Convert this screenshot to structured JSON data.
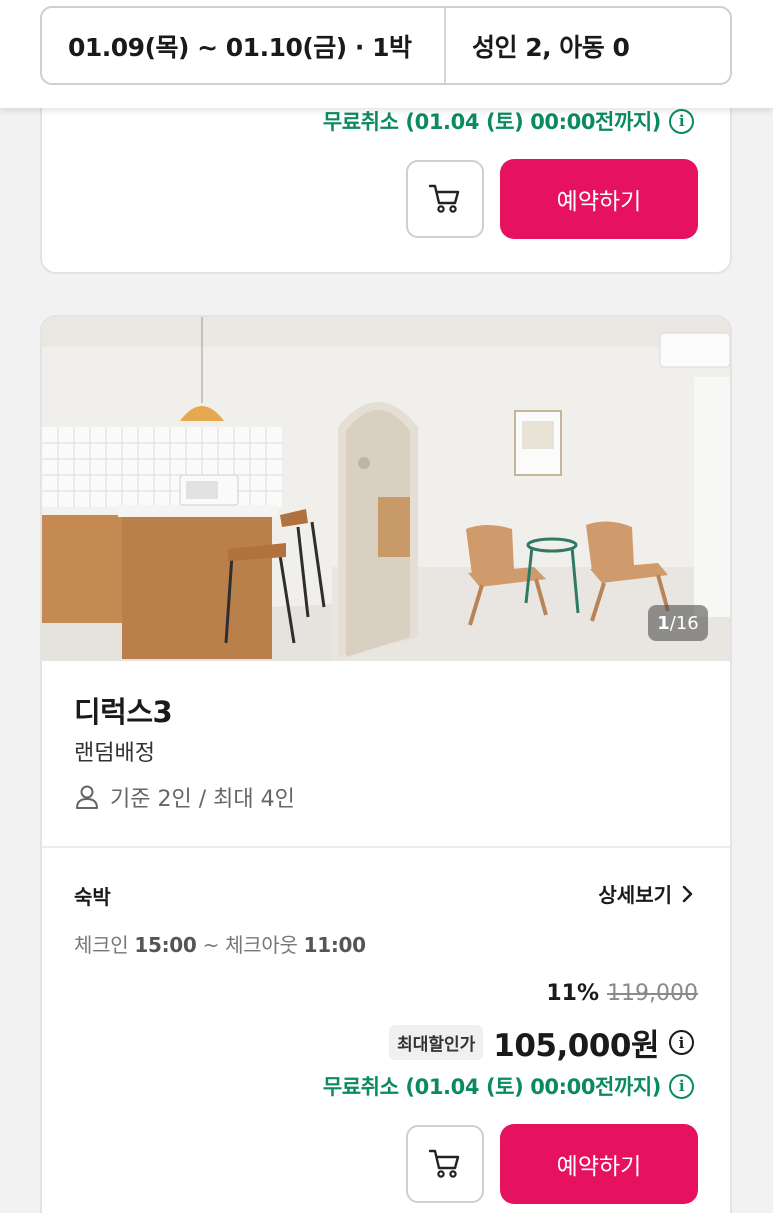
{
  "search": {
    "date_range": "01.09(목) ~ 01.10(금) · 1박",
    "guests": "성인 2, 아동 0"
  },
  "prev_room": {
    "free_cancel": "무료취소 (01.04 (토) 00:00전까지)",
    "reserve_label": "예약하기"
  },
  "room": {
    "photo_counter_current": "1",
    "photo_counter_total": "/16",
    "name": "디럭스3",
    "type": "랜덤배정",
    "capacity": "기준 2인 / 최대 4인",
    "stay_label": "숙박",
    "details_label": "상세보기",
    "checkin_label": "체크인",
    "checkin_time": "15:00",
    "separator": "~",
    "checkout_label": "체크아웃",
    "checkout_time": "11:00",
    "discount_pct": "11%",
    "original_price": "119,000",
    "max_discount_badge": "최대할인가",
    "final_price": "105,000원",
    "free_cancel": "무료취소 (01.04 (토) 00:00전까지)",
    "reserve_label": "예약하기"
  },
  "colors": {
    "accent": "#e7125f",
    "free_cancel_green": "#0b8a5f"
  },
  "icons": [
    "cart-icon",
    "info-icon",
    "person-icon",
    "chevron-right-icon"
  ]
}
